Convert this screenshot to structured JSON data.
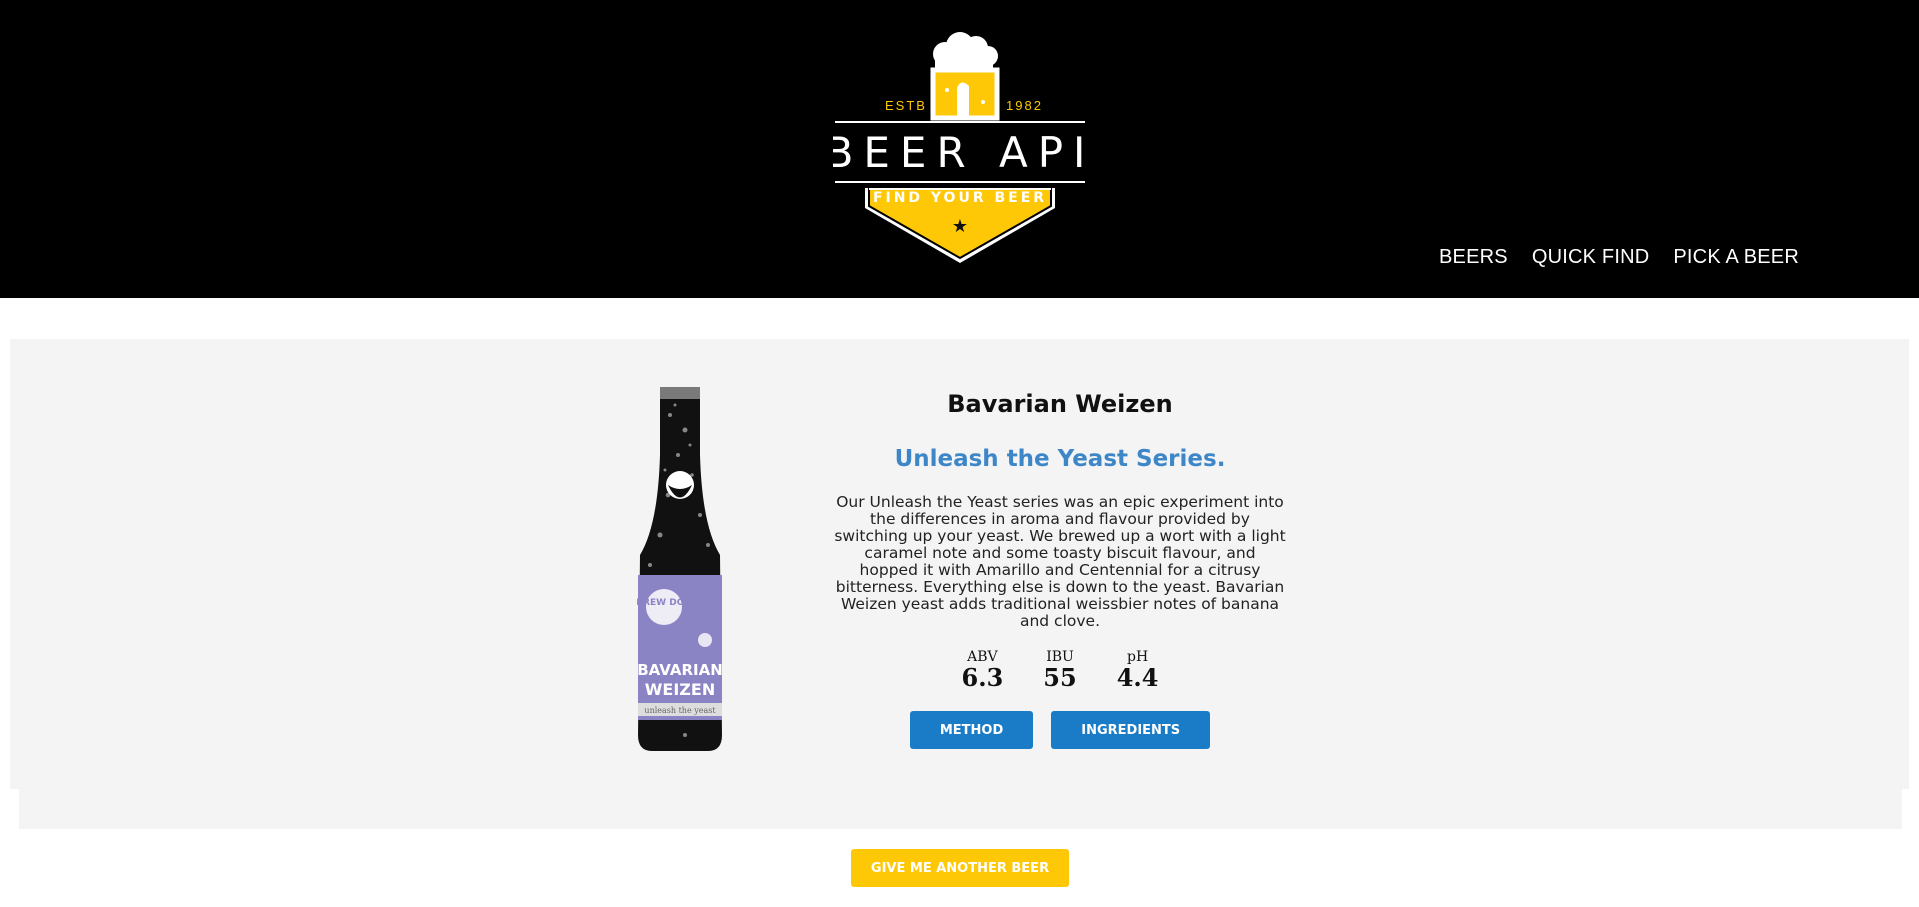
{
  "header": {
    "logo": {
      "estb_label": "ESTB",
      "year": "1982",
      "title": "BEER API",
      "ribbon": "FIND YOUR BEER",
      "icon": "beer-mug-icon"
    },
    "nav": [
      {
        "label": "BEERS"
      },
      {
        "label": "QUICK FIND"
      },
      {
        "label": "PICK A BEER"
      }
    ]
  },
  "beer": {
    "name": "Bavarian Weizen",
    "tagline": "Unleash the Yeast Series.",
    "description": "Our Unleash the Yeast series was an epic experiment into the differences in aroma and flavour provided by switching up your yeast. We brewed up a wort with a light caramel note and some toasty biscuit flavour, and hopped it with Amarillo and Centennial for a citrusy bitterness. Everything else is down to the yeast. Bavarian Weizen yeast adds traditional weissbier notes of banana and clove.",
    "stats": [
      {
        "label": "ABV",
        "value": "6.3"
      },
      {
        "label": "IBU",
        "value": "55"
      },
      {
        "label": "pH",
        "value": "4.4"
      }
    ],
    "bottle_label": {
      "brand": "BREW DOG",
      "line1": "BAVARIAN",
      "line2": "WEIZEN",
      "line3": "unleash the yeast",
      "label_color": "#8b84c4"
    }
  },
  "buttons": {
    "method": "METHOD",
    "ingredients": "INGREDIENTS",
    "another": "GIVE ME ANOTHER BEER"
  },
  "colors": {
    "header_bg": "#000000",
    "accent_yellow": "#ffc807",
    "button_blue": "#1a7cc6",
    "tagline_blue": "#3d87c9",
    "card_bg": "#f4f4f4"
  }
}
